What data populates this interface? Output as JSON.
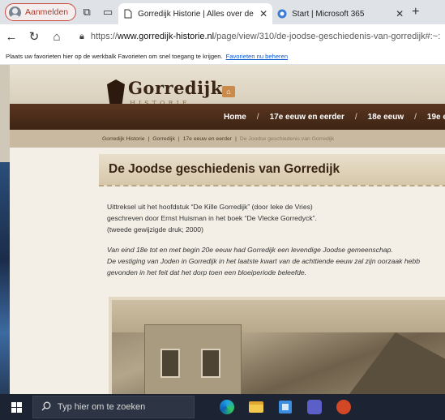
{
  "browser": {
    "profile_label": "Aanmelden",
    "tabs": [
      {
        "title": "Gorredijk Historie | Alles over de l",
        "close": "✕"
      },
      {
        "title": "Start | Microsoft 365",
        "close": "✕"
      }
    ],
    "new_tab": "+",
    "url_prefix": "https://",
    "url_host": "www.gorredijk-historie.nl",
    "url_path": "/page/view/310/de-joodse-geschiedenis-van-gorredijk#:~:",
    "favorites_bar_text": "Plaats uw favorieten hier op de werkbalk Favorieten om snel toegang te krijgen.",
    "favorites_link": "Favorieten nu beheren"
  },
  "site": {
    "logo_text": "Gorredijk",
    "logo_sub": "HISTORIE",
    "nav": [
      "Home",
      "17e eeuw en eerder",
      "18e eeuw",
      "19e ee"
    ],
    "nav_sep": "/",
    "breadcrumb": [
      "Gorredijk Historie",
      "Gorredijk",
      "17e eeuw en eerder",
      "De Joodse geschiedenis van Gorredijk"
    ],
    "breadcrumb_sep": "|",
    "page_title": "De Joodse geschiedenis van Gorredijk",
    "intro_lines": [
      "Uittreksel uit het hoofdstuk “De Kille Gorredijk” (door Ieke de Vries)",
      "geschreven door Ernst Huisman in het boek “De Vlecke Gorredyck”.",
      " (tweede gewijzigde druk; 2000)"
    ],
    "body_lines": [
      "Van eind 18e  tot en met begin 20e eeuw had Gorredijk een levendige Joodse gemeenschap.",
      "De vestiging van Joden in Gorredijk in het laatste kwart van de achttiende eeuw zal zijn oorzaak hebb",
      "gevonden in het feit dat het dorp toen een bloeiperiode beleefde."
    ]
  },
  "taskbar": {
    "search_placeholder": "Typ hier om te zoeken"
  }
}
